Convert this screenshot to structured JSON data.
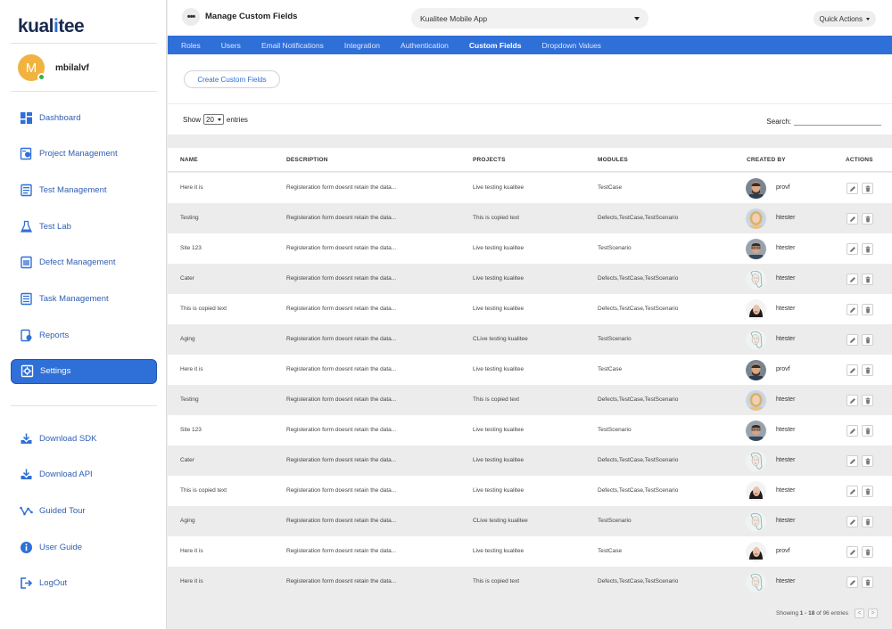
{
  "brand": {
    "logo_text": "kualitee"
  },
  "user": {
    "initial": "M",
    "name": "mbilalvf"
  },
  "nav": [
    {
      "key": "dashboard",
      "label": "Dashboard",
      "icon": "dashboard-icon"
    },
    {
      "key": "project-management",
      "label": "Project Management",
      "icon": "project-icon"
    },
    {
      "key": "test-management",
      "label": "Test Management",
      "icon": "test-management-icon"
    },
    {
      "key": "test-lab",
      "label": "Test Lab",
      "icon": "flask-icon"
    },
    {
      "key": "defect-management",
      "label": "Defect Management",
      "icon": "defect-icon"
    },
    {
      "key": "task-management",
      "label": "Task Management",
      "icon": "task-icon"
    },
    {
      "key": "reports",
      "label": "Reports",
      "icon": "reports-icon"
    },
    {
      "key": "settings",
      "label": "Settings",
      "icon": "settings-icon",
      "active": true
    }
  ],
  "nav_bottom": [
    {
      "key": "download-sdk",
      "label": "Download SDK",
      "icon": "download-icon"
    },
    {
      "key": "download-api",
      "label": "Download API",
      "icon": "download-icon"
    },
    {
      "key": "guided-tour",
      "label": "Guided Tour",
      "icon": "tour-icon"
    },
    {
      "key": "user-guide",
      "label": "User Guide",
      "icon": "info-icon"
    },
    {
      "key": "logout",
      "label": "LogOut",
      "icon": "logout-icon"
    }
  ],
  "header": {
    "title": "Manage Custom Fields",
    "project": "Kualitee Mobile App",
    "quick_actions": "Quick Actions"
  },
  "tabs": [
    {
      "label": "Roles"
    },
    {
      "label": "Users"
    },
    {
      "label": "Email Notifications"
    },
    {
      "label": "Integration"
    },
    {
      "label": "Authentication"
    },
    {
      "label": "Custom Fields",
      "active": true
    },
    {
      "label": "Dropdown Values"
    }
  ],
  "toolbar": {
    "create_label": "Create Custom Fields",
    "show_label": "Show",
    "entries_value": "20",
    "entries_label": "entries",
    "search_label": "Search:"
  },
  "table": {
    "columns": [
      "NAME",
      "DESCRIPTION",
      "PROJECTS",
      "MODULES",
      "CREATED BY",
      "ACTIONS"
    ],
    "rows": [
      {
        "name": "Here it is",
        "description": "Registeration form doesnt retain the data...",
        "project": "Live testing kualitee",
        "modules": "TestCase",
        "creator": "provf",
        "avatar": "man-beard"
      },
      {
        "name": "Testing",
        "description": "Registeration form doesnt retain the data...",
        "project": "This is copied text",
        "modules": "Defects,TestCase,TestScenario",
        "creator": "htester",
        "avatar": "woman-blonde"
      },
      {
        "name": "Site 123",
        "description": "Registeration form doesnt retain the data...",
        "project": "Live testing kualitee",
        "modules": "TestScenario",
        "creator": "htester",
        "avatar": "man-glasses"
      },
      {
        "name": "Cater",
        "description": "Registeration form doesnt retain the data...",
        "project": "Live testing kualitee",
        "modules": "Defects,TestCase,TestScenario",
        "creator": "htester",
        "avatar": "woman-sketch"
      },
      {
        "name": "This is copied text",
        "description": "Registeration form doesnt retain the data...",
        "project": "Live testing kualitee",
        "modules": "Defects,TestCase,TestScenario",
        "creator": "htester",
        "avatar": "woman-dark"
      },
      {
        "name": "Aging",
        "description": "Registeration form doesnt retain the data...",
        "project": "CLive testing kualitee",
        "modules": "TestScenario",
        "creator": "htester",
        "avatar": "woman-sketch"
      },
      {
        "name": "Here it is",
        "description": "Registeration form doesnt retain the data...",
        "project": "Live testing kualitee",
        "modules": "TestCase",
        "creator": "provf",
        "avatar": "man-beard"
      },
      {
        "name": "Testing",
        "description": "Registeration form doesnt retain the data...",
        "project": "This is copied text",
        "modules": "Defects,TestCase,TestScenario",
        "creator": "htester",
        "avatar": "woman-blonde"
      },
      {
        "name": "Site 123",
        "description": "Registeration form doesnt retain the data...",
        "project": "Live testing kualitee",
        "modules": "TestScenario",
        "creator": "htester",
        "avatar": "man-glasses"
      },
      {
        "name": "Cater",
        "description": "Registeration form doesnt retain the data...",
        "project": "Live testing kualitee",
        "modules": "Defects,TestCase,TestScenario",
        "creator": "htester",
        "avatar": "woman-sketch"
      },
      {
        "name": "This is copied text",
        "description": "Registeration form doesnt retain the data...",
        "project": "Live testing kualitee",
        "modules": "Defects,TestCase,TestScenario",
        "creator": "htester",
        "avatar": "woman-dark"
      },
      {
        "name": "Aging",
        "description": "Registeration form doesnt retain the data...",
        "project": "CLive testing kualitee",
        "modules": "TestScenario",
        "creator": "htester",
        "avatar": "woman-sketch"
      },
      {
        "name": "Here it is",
        "description": "Registeration form doesnt retain the data...",
        "project": "Live testing kualitee",
        "modules": "TestCase",
        "creator": "provf",
        "avatar": "woman-dark"
      },
      {
        "name": "Here it is",
        "description": "Registeration form doesnt retain the data...",
        "project": "This is copied text",
        "modules": "Defects,TestCase,TestScenario",
        "creator": "htester",
        "avatar": "woman-sketch"
      }
    ]
  },
  "pagination": {
    "showing_label": "Showing",
    "range": "1 - 18",
    "of_label": "of 96 entries",
    "prev": "<",
    "next": ">"
  },
  "colors": {
    "accent": "#2f6fd8",
    "nav_text": "#2f5fb3",
    "online": "#2fb344",
    "avatar_bg": "#f2b240"
  }
}
